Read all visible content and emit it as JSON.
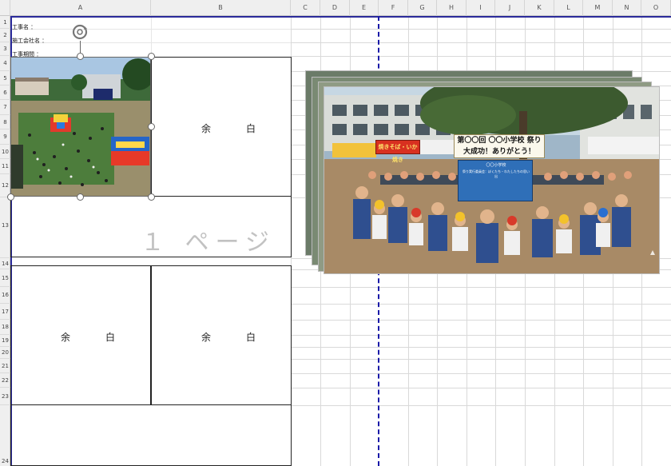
{
  "columns": [
    "A",
    "B",
    "C",
    "D",
    "E",
    "F",
    "G",
    "H",
    "I",
    "J",
    "K",
    "L",
    "M",
    "N",
    "O"
  ],
  "rows": [
    "1",
    "2",
    "3",
    "4",
    "5",
    "6",
    "7",
    "8",
    "9",
    "10",
    "11",
    "12",
    "13",
    "14",
    "15",
    "16",
    "17",
    "18",
    "19",
    "20",
    "21",
    "22",
    "23",
    "24"
  ],
  "form_labels": {
    "project_name": "工事名 ：",
    "contractor": "施工会社名 ：",
    "period": "工事期間 ："
  },
  "yohaku_label": "余　白",
  "page_watermark": "１ ページ",
  "photo_banner": {
    "line1": "第〇〇回 〇〇小学校 祭り",
    "line2": "大成功！ありがとう！"
  },
  "board": {
    "title": "〇〇小学校",
    "subtitle": "祭り実行委員会：ぼくたち・わたしたちの思い出"
  },
  "red_banner": "焼きそば・いか焼き",
  "colors": {
    "page_break": "#1a1aa8",
    "grid": "#d9d9d9",
    "header_bg": "#efefef"
  },
  "icons": {
    "rotate": "rotate-icon"
  }
}
